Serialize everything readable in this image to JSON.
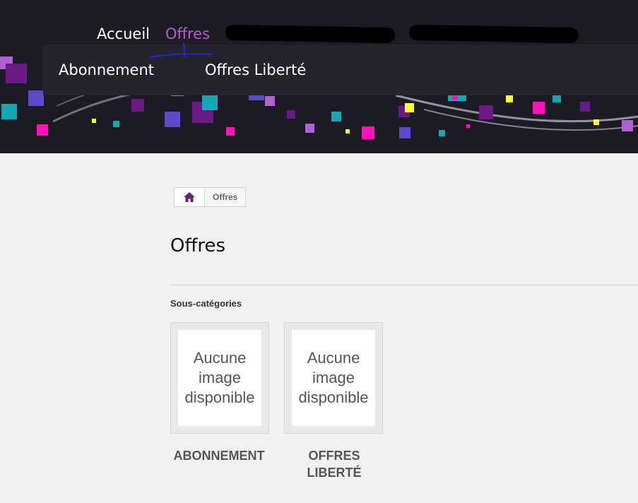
{
  "nav": {
    "items": [
      {
        "label": "Accueil",
        "active": false
      },
      {
        "label": "Offres",
        "active": true
      }
    ],
    "active_color": "#b45fc8"
  },
  "dropdown": {
    "items": [
      "Abonnement",
      "Offres Liberté"
    ]
  },
  "breadcrumb": {
    "home_icon": "home-icon",
    "current": "Offres"
  },
  "page": {
    "title": "Offres",
    "subcategories_heading": "Sous-catégories"
  },
  "subcategories": [
    {
      "name": "ABONNEMENT",
      "image_placeholder": "Aucune image disponible"
    },
    {
      "name": "OFFRES LIBERTÉ",
      "image_placeholder": "Aucune image disponible"
    }
  ],
  "colors": {
    "banner_bg": "#1c1a24",
    "accent": "#b45fc8",
    "home_icon": "#6b1f7c",
    "page_bg": "#f1f1f1"
  }
}
